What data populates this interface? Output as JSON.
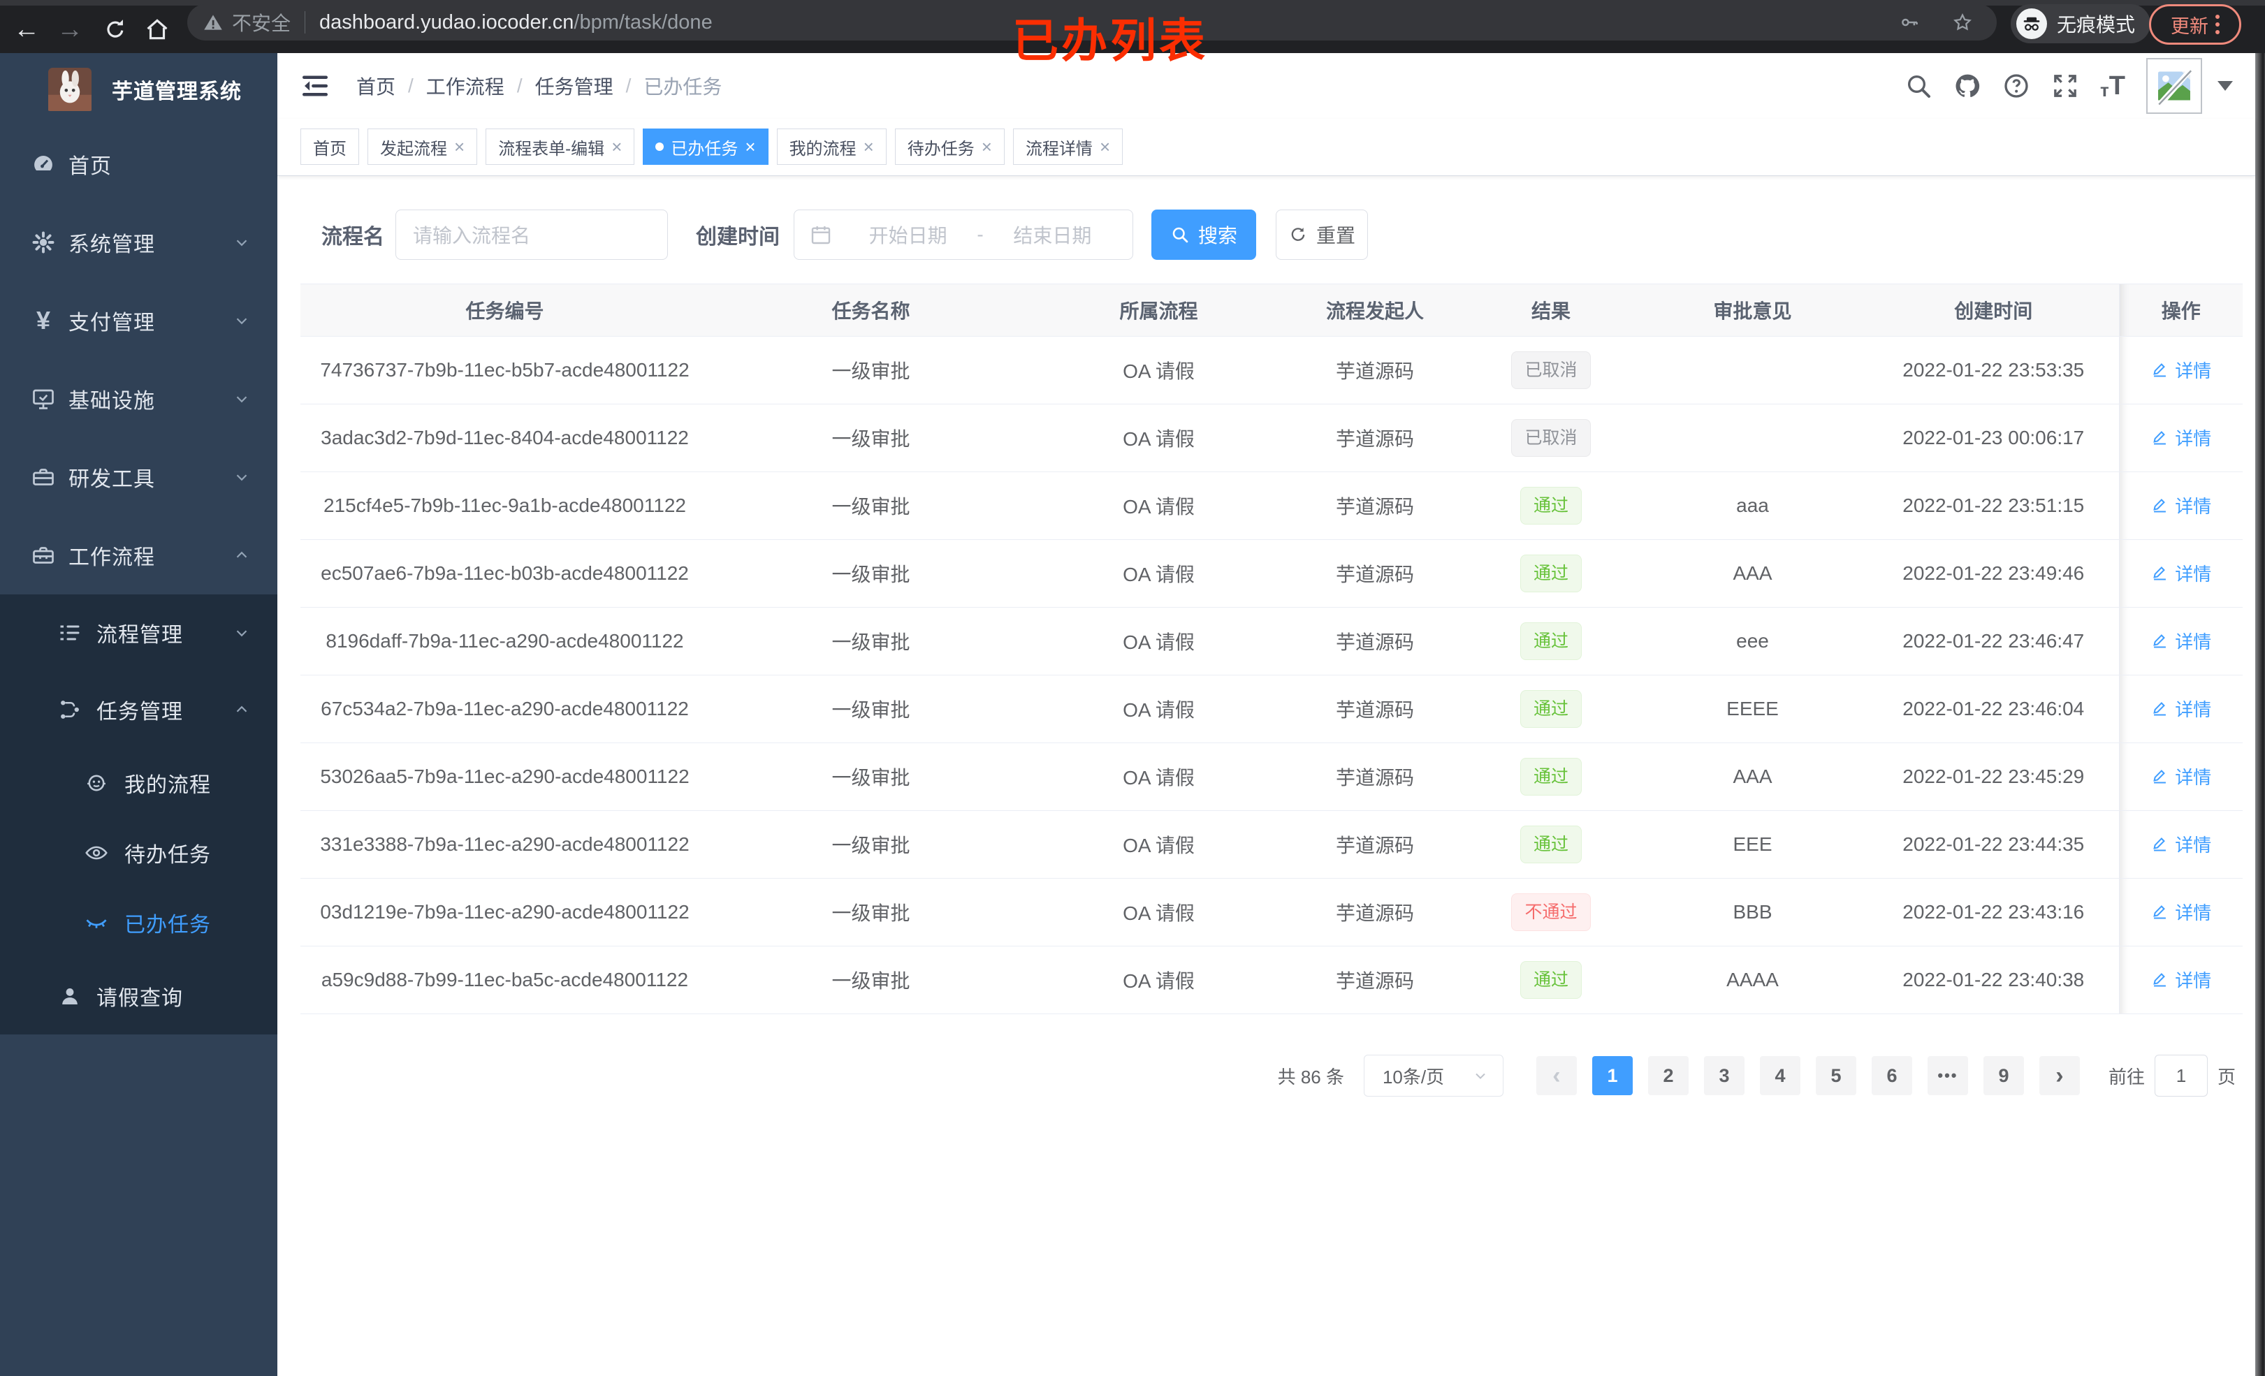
{
  "browser": {
    "security_label": "不安全",
    "url_host": "dashboard.yudao.iocoder.cn",
    "url_path": "/bpm/task/done",
    "incognito_label": "无痕模式",
    "update_label": "更新",
    "annotation": "已办列表"
  },
  "sidebar": {
    "app_title": "芋道管理系统",
    "items": [
      {
        "label": "首页",
        "icon": "dashboard-icon"
      },
      {
        "label": "系统管理",
        "icon": "gear-icon"
      },
      {
        "label": "支付管理",
        "icon": "yen-icon"
      },
      {
        "label": "基础设施",
        "icon": "monitor-icon"
      },
      {
        "label": "研发工具",
        "icon": "toolbox-icon"
      },
      {
        "label": "工作流程",
        "icon": "workflow-icon"
      }
    ],
    "submenu": [
      {
        "label": "流程管理",
        "icon": "list-icon"
      },
      {
        "label": "任务管理",
        "icon": "share-icon"
      },
      {
        "label": "请假查询",
        "icon": "person-icon"
      }
    ],
    "task_children": [
      {
        "label": "我的流程",
        "icon": "face-icon"
      },
      {
        "label": "待办任务",
        "icon": "eye-icon"
      },
      {
        "label": "已办任务",
        "icon": "eye-closed-icon"
      }
    ]
  },
  "breadcrumb": {
    "items": [
      "首页",
      "工作流程",
      "任务管理",
      "已办任务"
    ],
    "separator": "/"
  },
  "tabs": [
    {
      "label": "首页"
    },
    {
      "label": "发起流程"
    },
    {
      "label": "流程表单-编辑"
    },
    {
      "label": "已办任务"
    },
    {
      "label": "我的流程"
    },
    {
      "label": "待办任务"
    },
    {
      "label": "流程详情"
    }
  ],
  "filters": {
    "name_label": "流程名",
    "name_placeholder": "请输入流程名",
    "time_label": "创建时间",
    "start_placeholder": "开始日期",
    "range_separator": "-",
    "end_placeholder": "结束日期",
    "search_label": "搜索",
    "reset_label": "重置"
  },
  "table": {
    "columns": [
      "任务编号",
      "任务名称",
      "所属流程",
      "流程发起人",
      "结果",
      "审批意见",
      "创建时间",
      "操作"
    ],
    "action_label": "详情",
    "rows": [
      {
        "id": "74736737-7b9b-11ec-b5b7-acde48001122",
        "name": "一级审批",
        "process": "OA 请假",
        "starter": "芋道源码",
        "result": "已取消",
        "result_type": "info",
        "opinion": "",
        "created": "2022-01-22 23:53:35"
      },
      {
        "id": "3adac3d2-7b9d-11ec-8404-acde48001122",
        "name": "一级审批",
        "process": "OA 请假",
        "starter": "芋道源码",
        "result": "已取消",
        "result_type": "info",
        "opinion": "",
        "created": "2022-01-23 00:06:17"
      },
      {
        "id": "215cf4e5-7b9b-11ec-9a1b-acde48001122",
        "name": "一级审批",
        "process": "OA 请假",
        "starter": "芋道源码",
        "result": "通过",
        "result_type": "success",
        "opinion": "aaa",
        "created": "2022-01-22 23:51:15"
      },
      {
        "id": "ec507ae6-7b9a-11ec-b03b-acde48001122",
        "name": "一级审批",
        "process": "OA 请假",
        "starter": "芋道源码",
        "result": "通过",
        "result_type": "success",
        "opinion": "AAA",
        "created": "2022-01-22 23:49:46"
      },
      {
        "id": "8196daff-7b9a-11ec-a290-acde48001122",
        "name": "一级审批",
        "process": "OA 请假",
        "starter": "芋道源码",
        "result": "通过",
        "result_type": "success",
        "opinion": "eee",
        "created": "2022-01-22 23:46:47"
      },
      {
        "id": "67c534a2-7b9a-11ec-a290-acde48001122",
        "name": "一级审批",
        "process": "OA 请假",
        "starter": "芋道源码",
        "result": "通过",
        "result_type": "success",
        "opinion": "EEEE",
        "created": "2022-01-22 23:46:04"
      },
      {
        "id": "53026aa5-7b9a-11ec-a290-acde48001122",
        "name": "一级审批",
        "process": "OA 请假",
        "starter": "芋道源码",
        "result": "通过",
        "result_type": "success",
        "opinion": "AAA",
        "created": "2022-01-22 23:45:29"
      },
      {
        "id": "331e3388-7b9a-11ec-a290-acde48001122",
        "name": "一级审批",
        "process": "OA 请假",
        "starter": "芋道源码",
        "result": "通过",
        "result_type": "success",
        "opinion": "EEE",
        "created": "2022-01-22 23:44:35"
      },
      {
        "id": "03d1219e-7b9a-11ec-a290-acde48001122",
        "name": "一级审批",
        "process": "OA 请假",
        "starter": "芋道源码",
        "result": "不通过",
        "result_type": "danger",
        "opinion": "BBB",
        "created": "2022-01-22 23:43:16"
      },
      {
        "id": "a59c9d88-7b99-11ec-ba5c-acde48001122",
        "name": "一级审批",
        "process": "OA 请假",
        "starter": "芋道源码",
        "result": "通过",
        "result_type": "success",
        "opinion": "AAAA",
        "created": "2022-01-22 23:40:38"
      }
    ]
  },
  "pagination": {
    "total_text": "共 86 条",
    "page_size": "10条/页",
    "pages": [
      "1",
      "2",
      "3",
      "4",
      "5",
      "6",
      "•••",
      "9"
    ],
    "goto_label": "前往",
    "goto_value": "1",
    "page_unit": "页"
  },
  "colors": {
    "accent": "#409eff",
    "sidebar_bg": "#304156",
    "submenu_bg": "#1f2d3d",
    "success": "#67c23a",
    "danger": "#f56c6c",
    "info": "#909399",
    "annotation_red": "#fb2e02"
  }
}
